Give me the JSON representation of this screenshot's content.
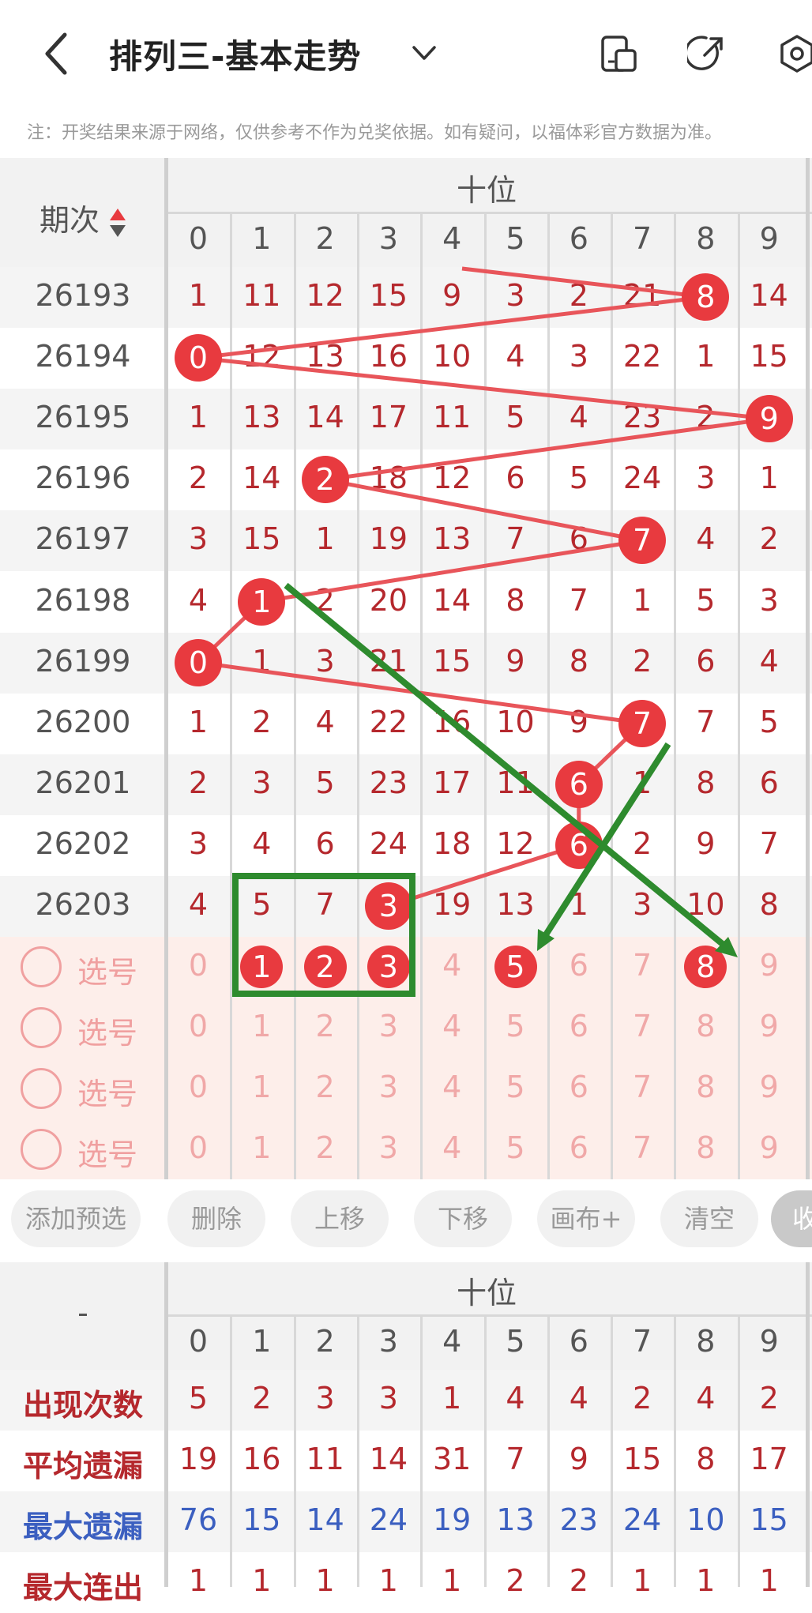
{
  "header": {
    "title": "排列三-基本走势",
    "notice": "注：开奖结果来源于网络，仅供参考不作为兑奖依据。如有疑问，以福体彩官方数据为准。"
  },
  "table": {
    "period_header": "期次",
    "group_header": "十位",
    "digits": [
      "0",
      "1",
      "2",
      "3",
      "4",
      "5",
      "6",
      "7",
      "8",
      "9"
    ],
    "rows": [
      {
        "period": "26193",
        "values": [
          "1",
          "11",
          "12",
          "15",
          "9",
          "3",
          "2",
          "21",
          "8",
          "14"
        ],
        "hit": 8
      },
      {
        "period": "26194",
        "values": [
          "0",
          "12",
          "13",
          "16",
          "10",
          "4",
          "3",
          "22",
          "1",
          "15"
        ],
        "hit": 0
      },
      {
        "period": "26195",
        "values": [
          "1",
          "13",
          "14",
          "17",
          "11",
          "5",
          "4",
          "23",
          "2",
          "9"
        ],
        "hit": 9
      },
      {
        "period": "26196",
        "values": [
          "2",
          "14",
          "2",
          "18",
          "12",
          "6",
          "5",
          "24",
          "3",
          "1"
        ],
        "hit": 2
      },
      {
        "period": "26197",
        "values": [
          "3",
          "15",
          "1",
          "19",
          "13",
          "7",
          "6",
          "7",
          "4",
          "2"
        ],
        "hit": 7
      },
      {
        "period": "26198",
        "values": [
          "4",
          "1",
          "2",
          "20",
          "14",
          "8",
          "7",
          "1",
          "5",
          "3"
        ],
        "hit": 1
      },
      {
        "period": "26199",
        "values": [
          "0",
          "1",
          "3",
          "21",
          "15",
          "9",
          "8",
          "2",
          "6",
          "4"
        ],
        "hit": 0
      },
      {
        "period": "26200",
        "values": [
          "1",
          "2",
          "4",
          "22",
          "16",
          "10",
          "9",
          "7",
          "7",
          "5"
        ],
        "hit": 7
      },
      {
        "period": "26201",
        "values": [
          "2",
          "3",
          "5",
          "23",
          "17",
          "11",
          "6",
          "1",
          "8",
          "6"
        ],
        "hit": 6
      },
      {
        "period": "26202",
        "values": [
          "3",
          "4",
          "6",
          "24",
          "18",
          "12",
          "6",
          "2",
          "9",
          "7"
        ],
        "hit": 6
      },
      {
        "period": "26203",
        "values": [
          "4",
          "5",
          "7",
          "3",
          "19",
          "13",
          "1",
          "3",
          "10",
          "8"
        ],
        "hit": 3
      }
    ],
    "select_label": "选号",
    "selected_first_row": [
      1,
      2,
      3,
      5,
      8
    ]
  },
  "buttons": [
    "添加预选",
    "删除",
    "上移",
    "下移",
    "画布+",
    "清空",
    "收"
  ],
  "stats": {
    "corner": "-",
    "group_header": "十位",
    "rows": [
      {
        "label": "出现次数",
        "values": [
          "5",
          "2",
          "3",
          "3",
          "1",
          "4",
          "4",
          "2",
          "4",
          "2"
        ],
        "color": "#b5282d"
      },
      {
        "label": "平均遗漏",
        "values": [
          "19",
          "16",
          "11",
          "14",
          "31",
          "7",
          "9",
          "15",
          "8",
          "17"
        ],
        "color": "#b5282d"
      },
      {
        "label": "最大遗漏",
        "values": [
          "76",
          "15",
          "14",
          "24",
          "19",
          "13",
          "23",
          "24",
          "10",
          "15"
        ],
        "color": "#3b5fc0"
      },
      {
        "label": "最大连出",
        "values": [
          "1",
          "1",
          "1",
          "1",
          "1",
          "2",
          "2",
          "1",
          "1",
          "1"
        ],
        "color": "#b5282d"
      }
    ]
  },
  "colors": {
    "accent": "#e83a3f",
    "annotation": "#2e8b2e",
    "value_text": "#b5282d",
    "pink_row": "#fdeeea"
  }
}
